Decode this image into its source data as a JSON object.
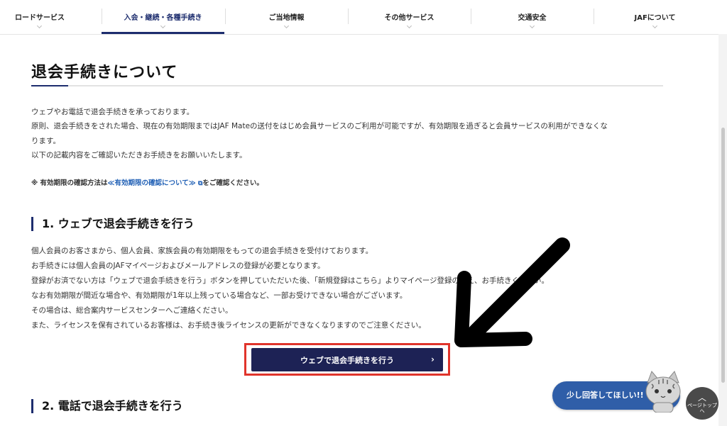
{
  "nav": {
    "items": [
      {
        "label": "ロードサービス"
      },
      {
        "label": "入会・継続・各種手続き"
      },
      {
        "label": "ご当地情報"
      },
      {
        "label": "その他サービス"
      },
      {
        "label": "交通安全"
      },
      {
        "label": "JAFについて"
      }
    ],
    "active": "入会・継続・各種手続き"
  },
  "page": {
    "title": "退会手続きについて",
    "intro": [
      "ウェブやお電話で退会手続きを承っております。",
      "原則、退会手続きをされた場合、現在の有効期限まではJAF Mateの送付をはじめ会員サービスのご利用が可能ですが、有効期限を過ぎると会員サービスの利用ができなくな",
      "ります。",
      "以下の記載内容をご確認いただきお手続きをお願いいたします。"
    ],
    "note": {
      "prefix": "※ 有効期限の確認方法は",
      "link": "≪有効期限の確認について≫",
      "suffix": "をご確認ください。"
    }
  },
  "section1": {
    "heading": "1. ウェブで退会手続きを行う",
    "lines": [
      "個人会員のお客さまから、個人会員、家族会員の有効期限をもっての退会手続きを受付けております。",
      "お手続きには個人会員のJAFマイページおよびメールアドレスの登録が必要となります。",
      "登録がお済でない方は「ウェブで退会手続きを行う」ボタンを押していただいた後、「新規登録はこちら」よりマイページ登録のうえ、お手続きください。",
      "なお有効期限が間近な場合や、有効期限が1年以上残っている場合など、一部お受けできない場合がございます。",
      "その場合は、総合案内サービスセンターへご連絡ください。",
      "また、ライセンスを保有されているお客様は、お手続き後ライセンスの更新ができなくなりますのでご注意ください。"
    ],
    "cta_label": "ウェブで退会手続きを行う",
    "cta_chevron": "›"
  },
  "section2": {
    "heading": "2. 電話で退会手続きを行う"
  },
  "widgets": {
    "feedback_label": "少し回答してほしい!!",
    "pagetop_label": "ページトップへ",
    "pagetop_arrow": "︿"
  },
  "colors": {
    "accent": "#1d2d6e",
    "cta_bg": "#1d2255",
    "highlight": "#e0342b",
    "link": "#1f5fb5",
    "feedback_bg": "#2f5ea8"
  },
  "icons": {
    "external_link": "external-link-icon",
    "chevron": "chevron-down-icon"
  }
}
